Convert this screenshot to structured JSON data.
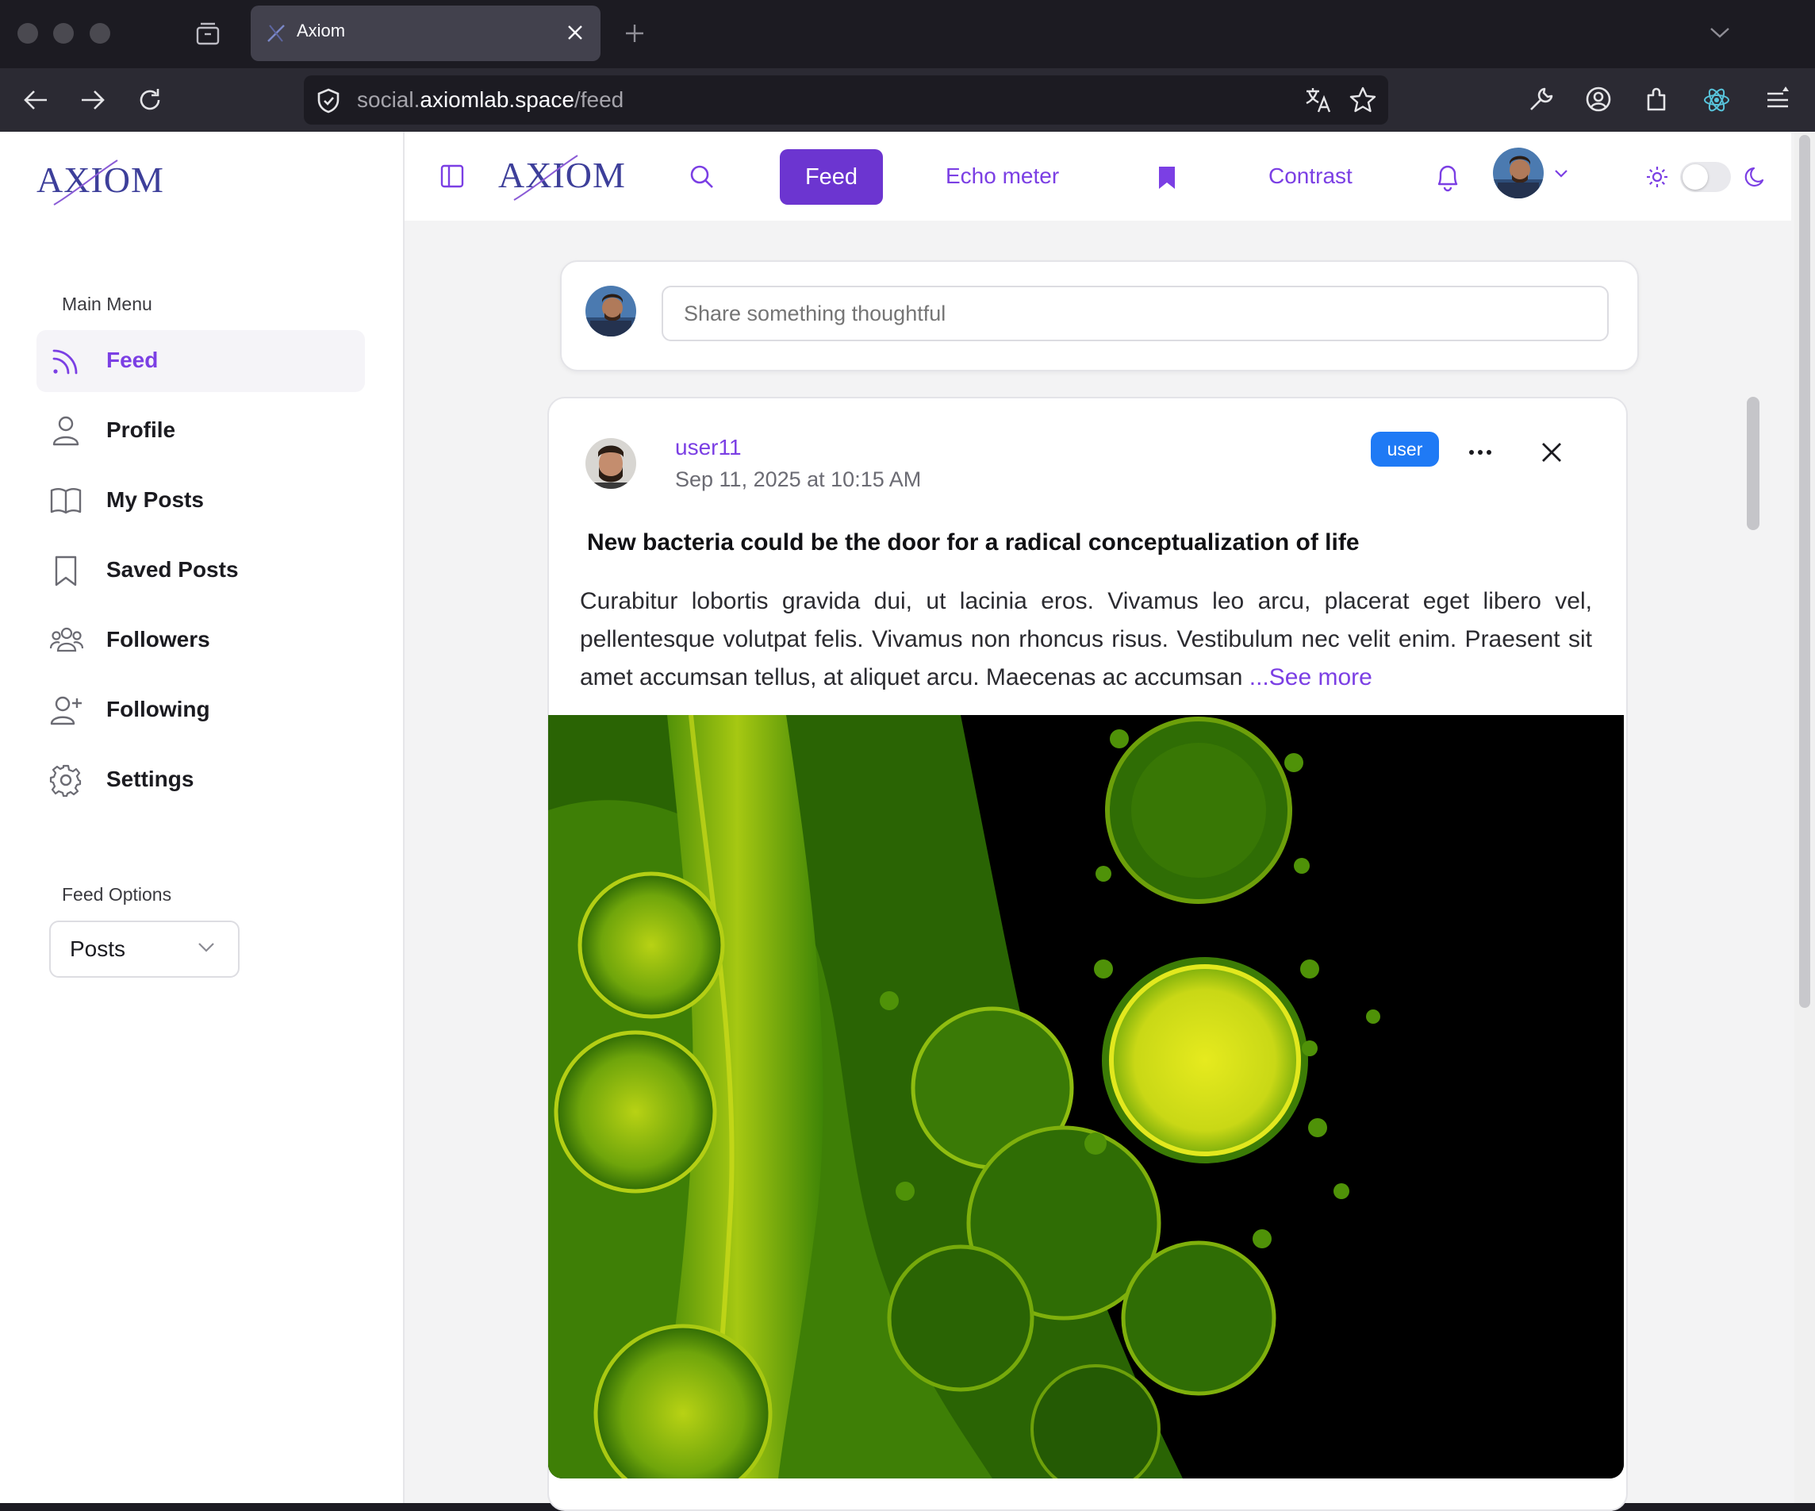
{
  "browser": {
    "tab_title": "Axiom",
    "url_domain_prefix": "social.",
    "url_domain_main": "axiomlab.space",
    "url_path": "/feed"
  },
  "app": {
    "logo_text": "AXIOM",
    "accent_color": "#7b3fe4",
    "badge_color": "#1f7af5"
  },
  "sidebar": {
    "main_menu_label": "Main Menu",
    "items": [
      {
        "label": "Feed",
        "icon": "rss-icon",
        "active": true
      },
      {
        "label": "Profile",
        "icon": "user-icon"
      },
      {
        "label": "My Posts",
        "icon": "book-icon"
      },
      {
        "label": "Saved Posts",
        "icon": "bookmark-icon"
      },
      {
        "label": "Followers",
        "icon": "users-icon"
      },
      {
        "label": "Following",
        "icon": "user-plus-icon"
      },
      {
        "label": "Settings",
        "icon": "gear-icon"
      }
    ],
    "feed_options_label": "Feed Options",
    "feed_options_value": "Posts"
  },
  "topnav": {
    "feed": "Feed",
    "echo_meter": "Echo meter",
    "contrast": "Contrast"
  },
  "composer": {
    "placeholder": "Share something thoughtful"
  },
  "post": {
    "username": "user11",
    "timestamp": "Sep 11, 2025 at 10:15 AM",
    "role_badge": "user",
    "title": "New bacteria could be the door for a radical conceptualization of life",
    "body": "Curabitur lobortis gravida dui, ut lacinia eros. Vivamus leo arcu, placerat eget libero vel, pellentesque volutpat felis. Vivamus non rhoncus risus. Vestibulum nec velit enim. Praesent sit amet accumsan tellus, at aliquet arcu. Maecenas ac accumsan",
    "see_more": "...See more",
    "image_subject": "green fluorescent microscopy of bacteria"
  }
}
